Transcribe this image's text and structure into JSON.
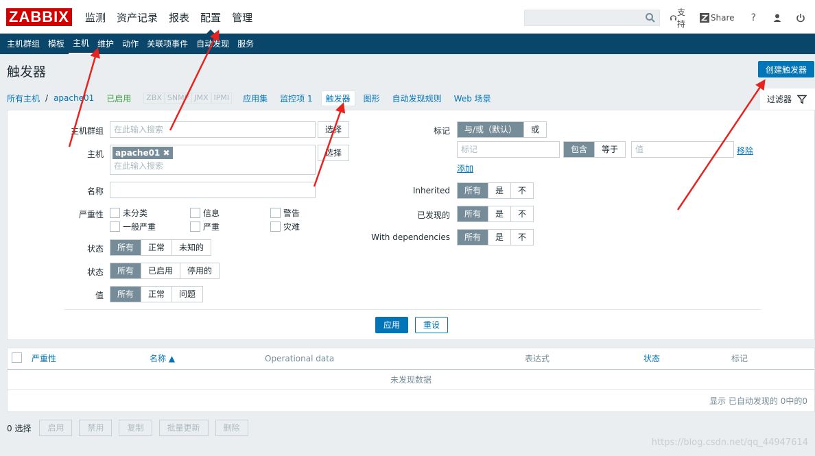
{
  "header": {
    "logo": "ZABBIX",
    "menu": [
      "监测",
      "资产记录",
      "报表",
      "配置",
      "管理"
    ],
    "active_menu": "配置",
    "support": "支持",
    "share": "Share",
    "help": "?"
  },
  "subnav": {
    "items": [
      "主机群组",
      "模板",
      "主机",
      "维护",
      "动作",
      "关联项事件",
      "自动发现",
      "服务"
    ]
  },
  "page": {
    "title": "触发器",
    "create_button": "创建触发器"
  },
  "hostnav": {
    "all_hosts": "所有主机",
    "separator": "/",
    "host": "apache01",
    "status": "已启用",
    "interfaces": [
      "ZBX",
      "SNMP",
      "JMX",
      "IPMI"
    ],
    "links": [
      "应用集",
      "监控项 1",
      "触发器",
      "图形",
      "自动发现规则",
      "Web 场景"
    ]
  },
  "filter": {
    "tab_label": "过滤器",
    "host_groups_label": "主机群组",
    "host_groups_placeholder": "在此输入搜索",
    "select": "选择",
    "host_label": "主机",
    "host_chip": "apache01",
    "host_placeholder": "在此输入搜索",
    "name_label": "名称",
    "severity_label": "严重性",
    "severities": [
      "未分类",
      "信息",
      "警告",
      "一般严重",
      "严重",
      "灾难"
    ],
    "state_label": "状态",
    "state_options": [
      "所有",
      "正常",
      "未知的"
    ],
    "status_label": "状态",
    "status_options": [
      "所有",
      "已启用",
      "停用的"
    ],
    "value_label": "值",
    "value_options": [
      "所有",
      "正常",
      "问题"
    ],
    "tags_label": "标记",
    "tag_mode": [
      "与/或（默认）",
      "或"
    ],
    "tag_placeholder": "标记",
    "tag_operators": [
      "包含",
      "等于"
    ],
    "value_placeholder": "值",
    "remove": "移除",
    "add": "添加",
    "inherited_label": "Inherited",
    "discovered_label": "已发现的",
    "dependencies_label": "With dependencies",
    "tri_options": [
      "所有",
      "是",
      "不"
    ],
    "apply": "应用",
    "reset": "重设"
  },
  "table": {
    "columns": [
      "严重性",
      "名称 ▲",
      "Operational data",
      "表达式",
      "状态",
      "标记"
    ],
    "empty": "未发现数据",
    "footer": "显示 已自动发现的 0中的0"
  },
  "actions": {
    "selected": "0 选择",
    "buttons": [
      "启用",
      "禁用",
      "复制",
      "批量更新",
      "删除"
    ]
  },
  "watermark": "https://blog.csdn.net/qq_44947614"
}
